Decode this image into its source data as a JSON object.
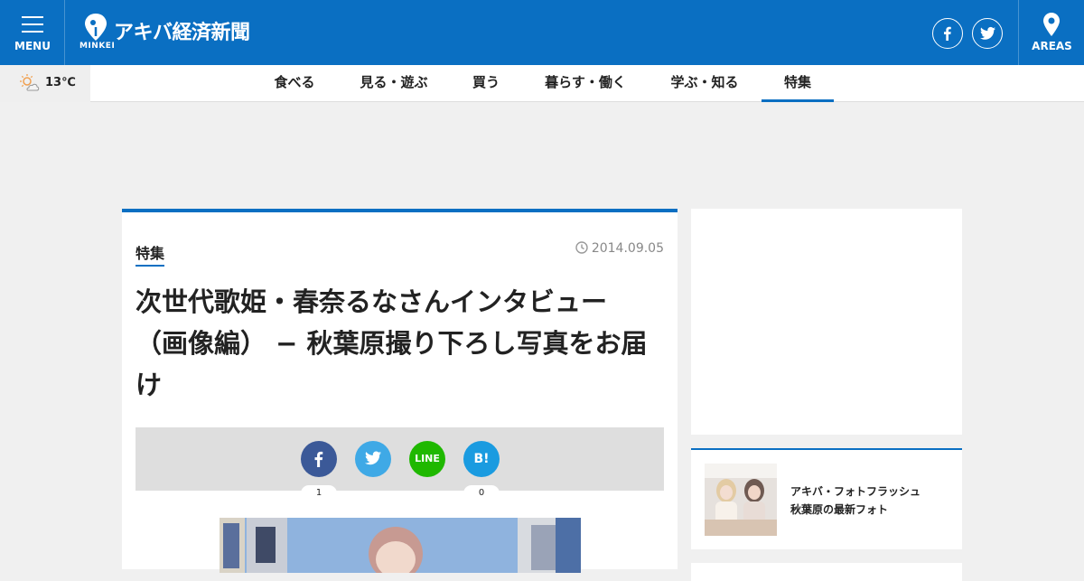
{
  "header": {
    "menu_label": "MENU",
    "logo_sub": "MINKEI",
    "site_name": "アキバ経済新聞",
    "areas_label": "AREAS",
    "brand_color": "#0a6fc2"
  },
  "weather": {
    "temperature": "13℃",
    "icon": "sun-cloud-icon"
  },
  "nav": {
    "items": [
      {
        "label": "食べる"
      },
      {
        "label": "見る・遊ぶ"
      },
      {
        "label": "買う"
      },
      {
        "label": "暮らす・働く"
      },
      {
        "label": "学ぶ・知る"
      },
      {
        "label": "特集"
      }
    ],
    "active_index": 5
  },
  "article": {
    "category": "特集",
    "date": "2014.09.05",
    "title_line1": "次世代歌姫・春奈るなさんインタビュー",
    "title_line2": "（画像編） − 秋葉原撮り下ろし写真をお届",
    "title_line3": "け"
  },
  "share": {
    "facebook_count": "1",
    "line_label": "LINE",
    "hatena_label": "B!",
    "hatena_count": "0"
  },
  "sidebar": {
    "flash_line1": "アキバ・フォトフラッシュ",
    "flash_line2": "秋葉原の最新フォト"
  }
}
